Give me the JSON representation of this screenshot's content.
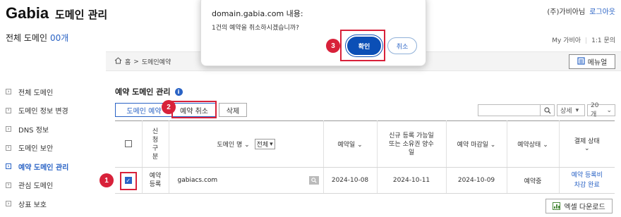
{
  "header": {
    "logo": "Gabia",
    "logo_sub": "도메인 관리",
    "total_label": "전체 도메인",
    "total_count": "00개",
    "user_name": "(주)가비아님",
    "logout": "로그아웃",
    "my_gabia": "My 가비아",
    "inquiry": "1:1 문의"
  },
  "breadcrumb": {
    "home": "홈",
    "sep": ">",
    "current": "도메인예약"
  },
  "manual_button": "메뉴얼",
  "sidebar": {
    "items": [
      {
        "label": "전체 도메인",
        "active": false
      },
      {
        "label": "도메인 정보 변경",
        "active": false
      },
      {
        "label": "DNS 정보",
        "active": false
      },
      {
        "label": "도메인 보안",
        "active": false
      },
      {
        "label": "예약 도메인 관리",
        "active": true
      },
      {
        "label": "관심 도메인",
        "active": false
      },
      {
        "label": "상표 보호",
        "active": false
      }
    ]
  },
  "main": {
    "title": "예약 도메인 관리",
    "buttons": {
      "reserve": "도메인 예약",
      "cancel_reserve": "예약 취소",
      "delete": "삭제"
    },
    "search": {
      "placeholder": "",
      "sort_label": "상세",
      "page_size": "20개"
    },
    "table": {
      "headers": {
        "type": "신\n청\n구\n분",
        "domain": "도메인 명",
        "domain_filter": "전체",
        "reserve_date": "예약일",
        "available_date": "신규 등록 가능일\n또는 소유권 양수\n일",
        "deadline": "예약 마감일",
        "status": "예약상태",
        "payment": "결제 상태"
      },
      "rows": [
        {
          "type": "예약\n등록",
          "domain": "gabiacs.com",
          "reserve_date": "2024-10-08",
          "available_date": "2024-10-11",
          "deadline": "2024-10-09",
          "status": "예약중",
          "payment": "예약 등록비\n차감 완료"
        }
      ]
    },
    "excel_button": "엑셀 다운로드"
  },
  "dialog": {
    "title": "domain.gabia.com 내용:",
    "message": "1건의 예약을 취소하시겠습니까?",
    "ok": "확인",
    "cancel": "취소"
  },
  "annotations": {
    "step1": "1",
    "step2": "2",
    "step3": "3",
    "color": "#d8213a"
  }
}
